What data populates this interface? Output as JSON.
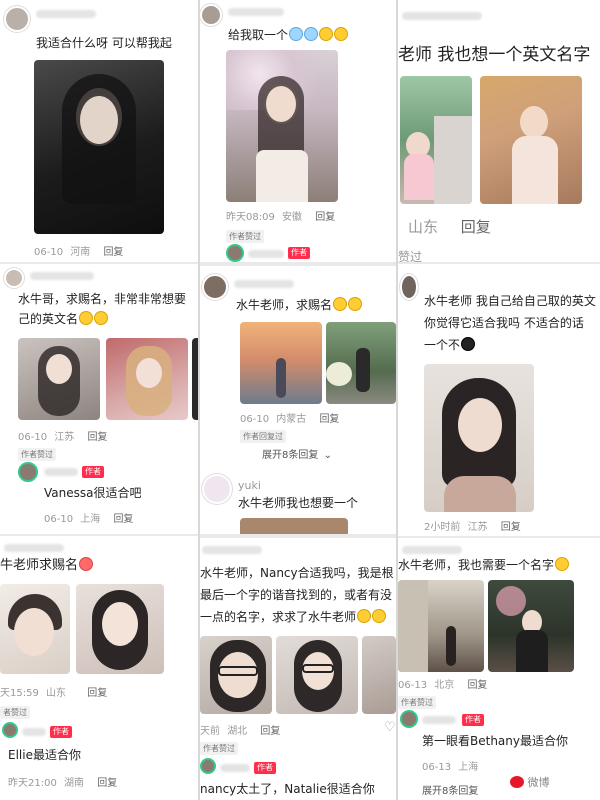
{
  "posts": [
    {
      "text": "我适合什么呀  可以帮我起",
      "date": "06-10",
      "loc": "河南",
      "reply": "回复"
    },
    {
      "text": "给我取一个",
      "date": "昨天08:09",
      "loc": "安徽",
      "reply": "回复",
      "liked": "作者赞过",
      "author": "作者"
    },
    {
      "text": "老师  我也想一个英文名字",
      "loc": "山东",
      "reply": "回复",
      "tail": "赞过"
    },
    {
      "text1": "水牛哥，求赐名，非常非常想要",
      "text2": "己的英文名",
      "date": "06-10",
      "loc": "江苏",
      "reply": "回复",
      "liked": "作者赞过",
      "author": "作者",
      "author_reply": "Vanessa很适合吧",
      "author_date": "06-10",
      "author_loc": "上海",
      "author_reply_btn": "回复"
    },
    {
      "text": "水牛老师，求赐名",
      "date": "06-10",
      "loc": "内蒙古",
      "reply": "回复",
      "liked": "作者回复过",
      "expand": "展开8条回复",
      "user2": "yuki",
      "text2": "水牛老师我也想要一个"
    },
    {
      "text1": "水牛老师  我自己给自己取的英文",
      "text2": "你觉得它适合我吗  不适合的话",
      "text3": "一个不",
      "time": "2小时前",
      "loc": "江苏",
      "reply": "回复"
    },
    {
      "text": "牛老师求赐名",
      "time": "天15:59",
      "loc": "山东",
      "reply": "回复",
      "liked": "者赞过",
      "author": "作者",
      "author_reply": "Ellie最适合你",
      "author_time": "昨天21:00",
      "author_loc": "湖南",
      "author_reply_btn": "回复"
    },
    {
      "text1": "水牛老师，Nancy合适我吗，我是根",
      "text2": "最后一个字的谐音找到的，或者有没",
      "text3": "一点的名字，求求了水牛老师",
      "time": "天前",
      "loc": "湖北",
      "reply": "回复",
      "liked": "作者赞过",
      "author": "作者",
      "author_reply": "nancy太土了，Natalie很适合你"
    },
    {
      "text": "水牛老师，我也需要一个名字",
      "date": "06-13",
      "loc": "北京",
      "reply": "回复",
      "liked": "作者赞过",
      "author": "作者",
      "author_reply": "第一眼看Bethany最适合你",
      "author_date": "06-13",
      "author_loc": "上海",
      "expand": "展开8条回复"
    }
  ],
  "watermark": "微博"
}
